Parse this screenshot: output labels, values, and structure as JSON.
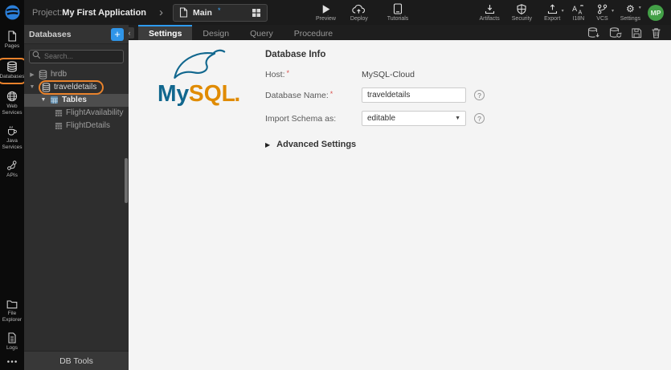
{
  "colors": {
    "accent_blue": "#2e9bef",
    "highlight_orange": "#e8822c",
    "avatar_green": "#43a047",
    "mysql_blue": "#11678e",
    "mysql_orange": "#e08b00",
    "required_red": "#d9534f"
  },
  "topbar": {
    "project_label": "Project:",
    "project_name": "My First Application",
    "breadcrumb_chevron": "›",
    "page_tab": {
      "label": "Main",
      "unsaved_mark": "*"
    },
    "actions_left": [
      {
        "label": "Preview",
        "icon": "play-icon"
      },
      {
        "label": "Deploy",
        "icon": "cloud-upload-icon"
      }
    ],
    "tutorials": {
      "label": "Tutorials",
      "icon": "book-icon"
    },
    "actions_right": [
      {
        "label": "Artifacts",
        "icon": "download-icon",
        "caret": false
      },
      {
        "label": "Security",
        "icon": "shield-icon",
        "caret": false
      },
      {
        "label": "Export",
        "icon": "upload-icon",
        "caret": true
      },
      {
        "label": "I18N",
        "icon": "translate-icon",
        "caret": false
      },
      {
        "label": "VCS",
        "icon": "branch-icon",
        "caret": true
      },
      {
        "label": "Settings",
        "icon": "gear-icon",
        "caret": true
      }
    ],
    "avatar_initials": "MP"
  },
  "rail": {
    "top_items": [
      {
        "label": "Pages",
        "icon": "page-icon",
        "active": false
      },
      {
        "label": "Databases",
        "icon": "database-icon",
        "active": true
      },
      {
        "label": "Web Services",
        "icon": "globe-icon",
        "active": false
      },
      {
        "label": "Java Services",
        "icon": "coffee-icon",
        "active": false
      },
      {
        "label": "APIs",
        "icon": "api-icon",
        "active": false
      }
    ],
    "bottom_items": [
      {
        "label": "File Explorer",
        "icon": "folder-icon"
      },
      {
        "label": "Logs",
        "icon": "log-icon"
      },
      {
        "label": "",
        "icon": "more-icon"
      }
    ]
  },
  "panel": {
    "title": "Databases",
    "add_button_label": "+",
    "collapse_label": "«",
    "search_placeholder": "Search...",
    "tree": {
      "hrdb": {
        "label": "hrdb",
        "expanded": false
      },
      "traveldetails": {
        "label": "traveldetails",
        "expanded": true,
        "highlighted": true
      },
      "tables": {
        "label": "Tables",
        "expanded": true,
        "selected": true
      },
      "flight_availability": {
        "label": "FlightAvailability"
      },
      "flight_details": {
        "label": "FlightDetails"
      }
    },
    "footer_button": "DB Tools"
  },
  "content": {
    "tabs": [
      {
        "label": "Settings",
        "active": true
      },
      {
        "label": "Design",
        "active": false
      },
      {
        "label": "Query",
        "active": false
      },
      {
        "label": "Procedure",
        "active": false
      }
    ],
    "toolbar_icons": [
      "db-pull-icon",
      "db-refresh-icon",
      "save-icon",
      "delete-icon"
    ],
    "logo": {
      "text_my": "My",
      "text_sql": "SQL",
      "text_dot": "."
    },
    "form": {
      "heading": "Database Info",
      "required_mark": "*",
      "help_mark": "?",
      "host_label": "Host:",
      "host_value": "MySQL-Cloud",
      "dbname_label": "Database Name:",
      "dbname_value": "traveldetails",
      "schema_label": "Import Schema as:",
      "schema_value": "editable",
      "advanced_toggle": "Advanced Settings"
    }
  }
}
